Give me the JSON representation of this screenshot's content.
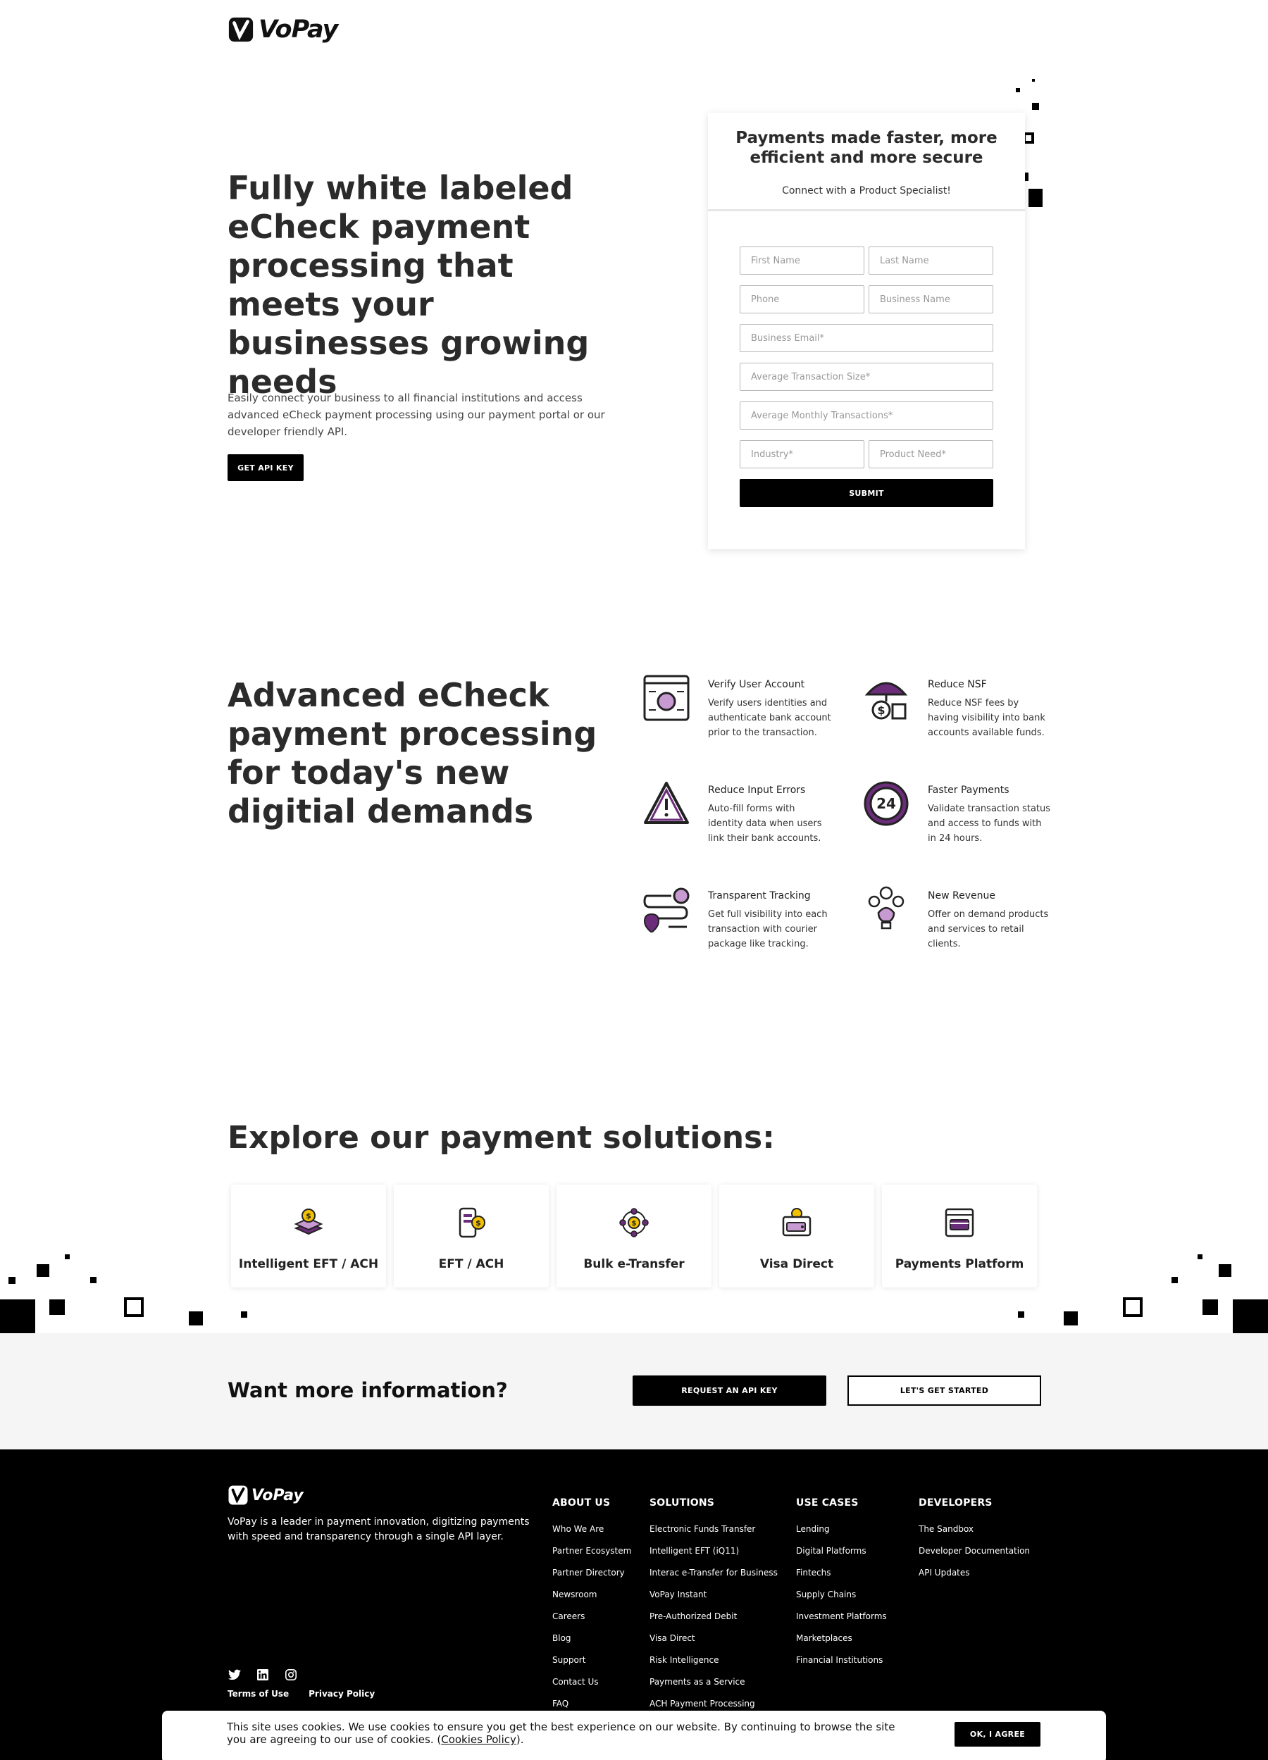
{
  "brand": {
    "name": "VoPay"
  },
  "hero": {
    "title": "Fully white labeled eCheck payment processing that meets your businesses growing needs",
    "description": "Easily connect your business to all financial institutions and access advanced eCheck payment processing using our payment portal or our developer friendly API.",
    "cta_label": "GET API KEY"
  },
  "form": {
    "title": "Payments made faster, more efficient and more secure",
    "subtitle": "Connect with a Product Specialist!",
    "fields": {
      "first_name": "First Name",
      "last_name": "Last Name",
      "phone": "Phone",
      "business_name": "Business Name",
      "business_email": "Business Email*",
      "avg_transaction_size": "Average Transaction Size*",
      "avg_monthly_transactions": "Average Monthly Transactions*",
      "industry": "Industry*",
      "product_need": "Product Need*"
    },
    "submit_label": "SUBMIT"
  },
  "features": {
    "title": "Advanced eCheck payment processing for today's new digitial demands",
    "items": [
      {
        "name": "Verify User Account",
        "text": "Verify users identities and authenticate bank account prior to the transaction.",
        "icon": "user-verify-icon"
      },
      {
        "name": "Reduce NSF",
        "text": "Reduce NSF fees by having visibility into bank accounts available funds.",
        "icon": "umbrella-money-icon"
      },
      {
        "name": "Reduce Input Errors",
        "text": "Auto-fill forms with identity data when users link their bank accounts.",
        "icon": "warning-icon"
      },
      {
        "name": "Faster Payments",
        "text": "Validate transaction status and access to funds with in 24 hours.",
        "icon": "clock-24-icon"
      },
      {
        "name": "Transparent Tracking",
        "text": "Get full visibility into each transaction with courier package like tracking.",
        "icon": "tracking-icon"
      },
      {
        "name": "New Revenue",
        "text": "Offer on demand products and services to retail clients.",
        "icon": "lightbulb-currency-icon"
      }
    ]
  },
  "solutions": {
    "title": "Explore our payment solutions:",
    "items": [
      {
        "label": "Intelligent EFT / ACH",
        "icon": "stacked-coin-icon"
      },
      {
        "label": "EFT / ACH",
        "icon": "mobile-coin-icon"
      },
      {
        "label": "Bulk e-Transfer",
        "icon": "network-coin-icon"
      },
      {
        "label": "Visa Direct",
        "icon": "wallet-card-icon"
      },
      {
        "label": "Payments Platform",
        "icon": "browser-card-icon"
      }
    ]
  },
  "cta": {
    "title": "Want more information?",
    "primary_label": "REQUEST AN API KEY",
    "secondary_label": "LET'S GET STARTED"
  },
  "footer": {
    "description": "VoPay is a leader in payment innovation, digitizing payments with speed and transparency through a single API layer.",
    "columns": [
      {
        "title": "ABOUT US",
        "links": [
          "Who We Are",
          "Partner Ecosystem",
          "Partner Directory",
          "Newsroom",
          "Careers",
          "Blog",
          "Support",
          "Contact Us",
          "FAQ"
        ]
      },
      {
        "title": "SOLUTIONS",
        "links": [
          "Electronic Funds Transfer",
          "Intelligent EFT (iQ11)",
          "Interac e-Transfer for Business",
          "VoPay Instant",
          "Pre-Authorized Debit",
          "Visa Direct",
          "Risk Intelligence",
          "Payments as a Service",
          "ACH Payment Processing"
        ]
      },
      {
        "title": "USE CASES",
        "links": [
          "Lending",
          "Digital Platforms",
          "Fintechs",
          "Supply Chains",
          "Investment Platforms",
          "Marketplaces",
          "Financial Institutions"
        ]
      },
      {
        "title": "DEVELOPERS",
        "links": [
          "The Sandbox",
          "Developer Documentation",
          "API Updates"
        ]
      }
    ],
    "legal": {
      "terms": "Terms of Use",
      "privacy": "Privacy Policy"
    }
  },
  "cookie": {
    "text": "This site uses cookies. We use cookies to ensure you get the best experience on our website. By continuing to browse the site you are agreeing to our use of cookies. (",
    "link_label": "Cookies Policy",
    "text_end": ").",
    "button_label": "OK, I AGREE"
  },
  "colors": {
    "accent": "#6b2c7a",
    "coin": "#f2c200",
    "dark": "#000000"
  }
}
